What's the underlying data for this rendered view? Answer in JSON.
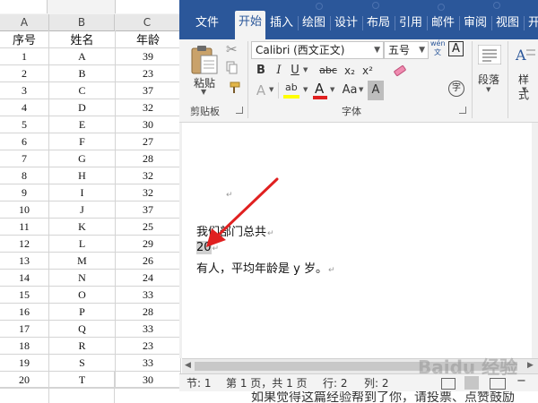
{
  "excel": {
    "columns": [
      "A",
      "B",
      "C"
    ],
    "headers": [
      "序号",
      "姓名",
      "年龄"
    ],
    "rows": [
      [
        "1",
        "A",
        "39"
      ],
      [
        "2",
        "B",
        "23"
      ],
      [
        "3",
        "C",
        "37"
      ],
      [
        "4",
        "D",
        "32"
      ],
      [
        "5",
        "E",
        "30"
      ],
      [
        "6",
        "F",
        "27"
      ],
      [
        "7",
        "G",
        "28"
      ],
      [
        "8",
        "H",
        "32"
      ],
      [
        "9",
        "I",
        "32"
      ],
      [
        "10",
        "J",
        "37"
      ],
      [
        "11",
        "K",
        "25"
      ],
      [
        "12",
        "L",
        "29"
      ],
      [
        "13",
        "M",
        "26"
      ],
      [
        "14",
        "N",
        "24"
      ],
      [
        "15",
        "O",
        "33"
      ],
      [
        "16",
        "P",
        "28"
      ],
      [
        "17",
        "Q",
        "33"
      ],
      [
        "18",
        "R",
        "23"
      ],
      [
        "19",
        "S",
        "33"
      ],
      [
        "20",
        "T",
        "30"
      ]
    ]
  },
  "word": {
    "tabs": [
      "文件",
      "开始",
      "插入",
      "绘图",
      "设计",
      "布局",
      "引用",
      "邮件",
      "审阅",
      "视图",
      "开发"
    ],
    "active_tab": "开始",
    "ribbon": {
      "paste_label": "粘贴",
      "clipboard_group": "剪贴板",
      "font_group": "字体",
      "font_name": "Calibri (西文正文)",
      "font_size": "五号",
      "wen_label": "wén\n文",
      "A_box": "A",
      "bold": "B",
      "italic": "I",
      "underline": "U",
      "strike": "abc",
      "sub": "x₂",
      "sup": "x²",
      "text_effect": "A",
      "highlight": "ab",
      "font_color": "A",
      "grow": "Aa",
      "char_shade": "A",
      "enclose": "字",
      "paragraph_label": "段落",
      "styles_label": "样式"
    },
    "doc_lines": [
      "我们部门总共",
      "20",
      "有人，平均年龄是 y 岁。"
    ],
    "statusbar": {
      "section": "节: 1",
      "page": "第 1 页，共 1 页",
      "row": "行: 2",
      "col": "列: 2"
    },
    "bottom_text": "如果觉得这篇经验帮到了你，请投票、点赞鼓励"
  },
  "watermark": "Baidu 经验",
  "colors": {
    "word_blue": "#2b579a",
    "arrow_red": "#e02020"
  }
}
